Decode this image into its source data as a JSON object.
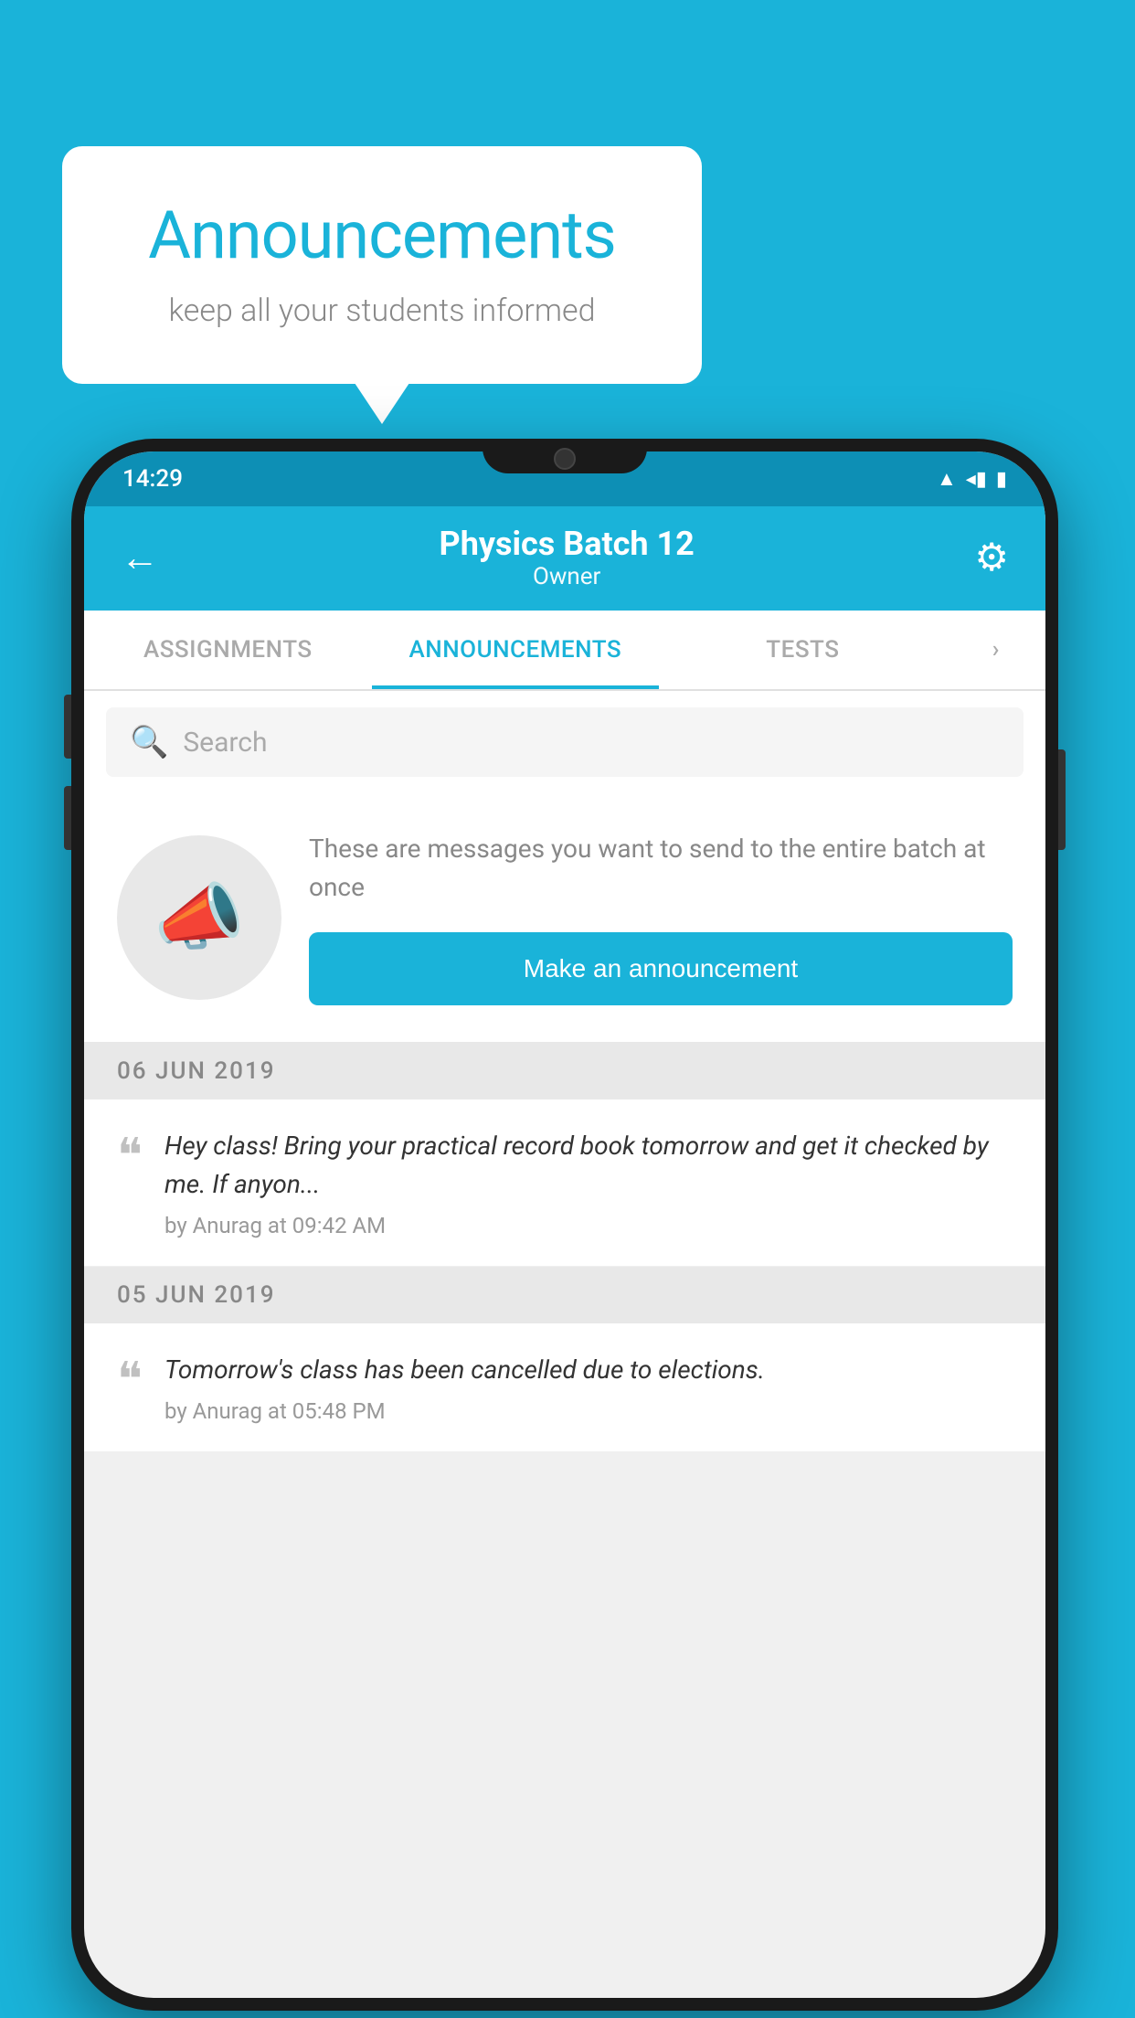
{
  "background_color": "#1ab3d9",
  "speech_bubble": {
    "title": "Announcements",
    "subtitle": "keep all your students informed"
  },
  "phone": {
    "status_bar": {
      "time": "14:29",
      "icons": [
        "▲",
        "◂",
        "▮"
      ]
    },
    "header": {
      "back_label": "←",
      "title": "Physics Batch 12",
      "subtitle": "Owner",
      "gear_label": "⚙"
    },
    "tabs": [
      {
        "label": "ASSIGNMENTS",
        "active": false
      },
      {
        "label": "ANNOUNCEMENTS",
        "active": true
      },
      {
        "label": "TESTS",
        "active": false
      },
      {
        "label": "›",
        "active": false
      }
    ],
    "search": {
      "placeholder": "Search"
    },
    "announcement_cta": {
      "description": "These are messages you want to send to the entire batch at once",
      "button_label": "Make an announcement"
    },
    "date_groups": [
      {
        "date": "06  JUN  2019",
        "items": [
          {
            "text": "Hey class! Bring your practical record book tomorrow and get it checked by me. If anyon...",
            "meta": "by Anurag at 09:42 AM"
          }
        ]
      },
      {
        "date": "05  JUN  2019",
        "items": [
          {
            "text": "Tomorrow's class has been cancelled due to elections.",
            "meta": "by Anurag at 05:48 PM"
          }
        ]
      }
    ]
  }
}
